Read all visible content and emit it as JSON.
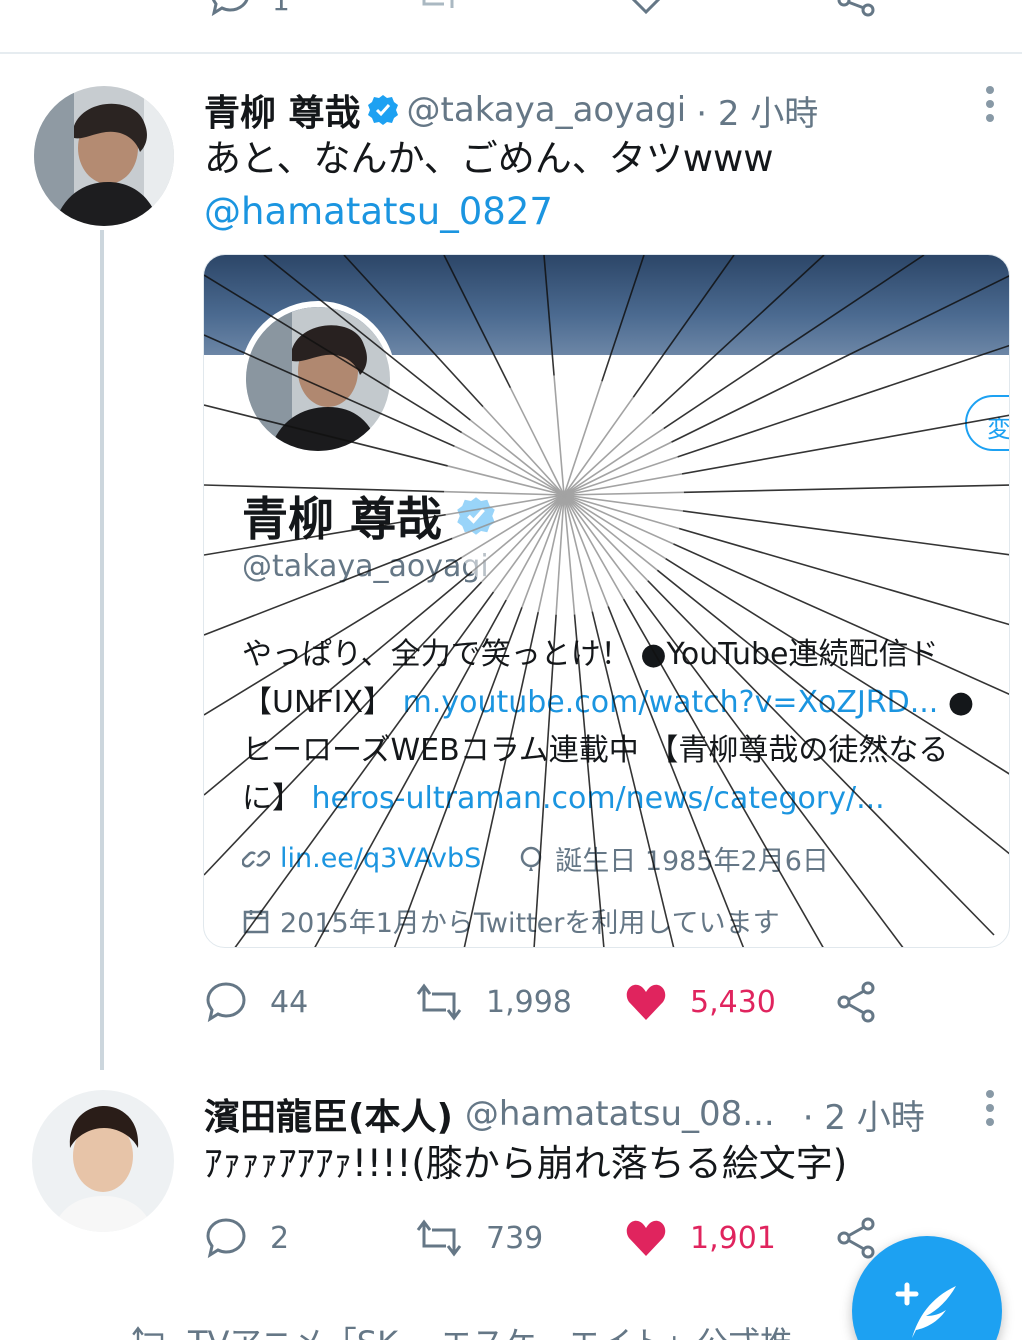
{
  "top_tweet_actions": {
    "reply_count": "1"
  },
  "tweet1": {
    "name": "青柳 尊哉",
    "handle": "@takaya_aoyagi",
    "time": "· 2 小時",
    "text": "あと、なんか、ごめん、タツwww",
    "mention": "@hamatatsu_0827",
    "card": {
      "name": "青柳 尊哉",
      "handle": "@takaya_aoyagi",
      "bio_line1": "やっぱり、全力で笑っとけ！ ●YouTube連続配信ド",
      "bio_line2_prefix": "【UNFIX】",
      "bio_line2_link": "m.youtube.com/watch?v=XoZJRD...",
      "bio_line2_suffix": "●",
      "bio_line3": "ヒーローズWEBコラム連載中 【青柳尊哉の徒然なる",
      "bio_line4_prefix": "に】",
      "bio_line4_link": "heros-ultraman.com/news/category/...",
      "website": "lin.ee/q3VAvbS",
      "birthday": "誕生日  1985年2月6日",
      "joined": "2015年1月からTwitterを利用しています",
      "edit_button": "変"
    },
    "replies": "44",
    "retweets": "1,998",
    "likes": "5,430"
  },
  "tweet2": {
    "name": "濱田龍臣(本人)",
    "handle": "@hamatatsu_08...",
    "time": "· 2 小時",
    "text": "ｱｧｧｧｱｱｱｧ!!!!(膝から崩れ落ちる絵文字)",
    "replies": "2",
    "retweets": "739",
    "likes": "1,901"
  },
  "bottom_peek": "TVアニメ「SKｰｰ エスケーエイト」公式推",
  "colors": {
    "accent": "#1da1f2",
    "like": "#e0245e",
    "link": "#1b95e0",
    "muted": "#657786"
  },
  "icons": [
    "reply-icon",
    "retweet-icon",
    "like-icon",
    "share-icon",
    "more-icon",
    "verified-icon",
    "compose-icon",
    "link-icon",
    "balloon-icon",
    "calendar-icon"
  ]
}
